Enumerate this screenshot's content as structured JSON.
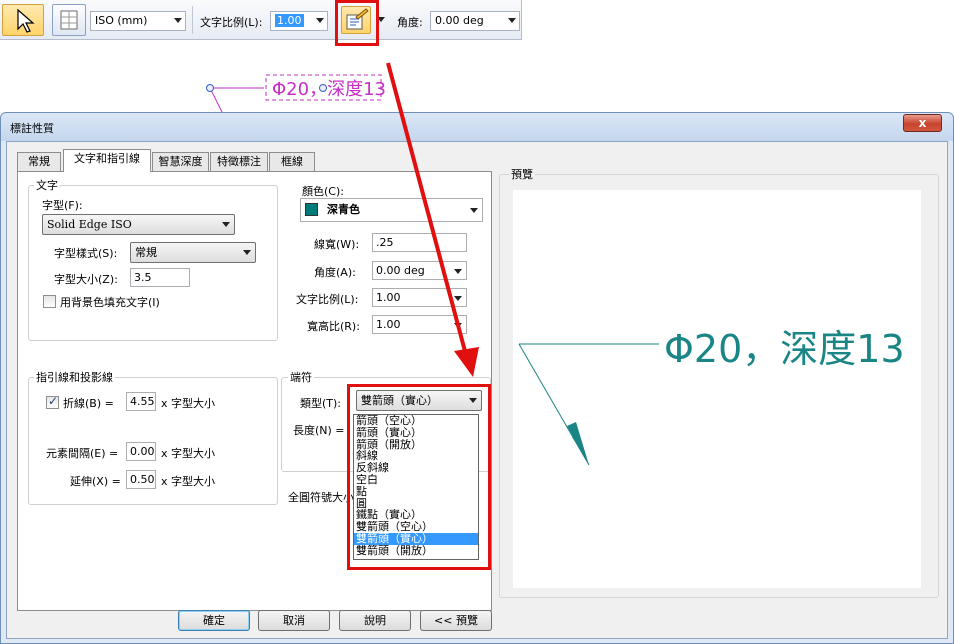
{
  "toolbar": {
    "standard_value": "ISO (mm)",
    "text_ratio_label": "文字比例(L):",
    "text_ratio_value": "1.00",
    "angle_label": "角度:",
    "angle_value": "0.00 deg"
  },
  "callout": {
    "text": "Φ20，深度13"
  },
  "dialog": {
    "title": "標註性質",
    "close_label": "x",
    "tabs": [
      "常規",
      "文字和指引線",
      "智慧深度",
      "特徵標注",
      "框線"
    ],
    "text_group": {
      "title": "文字",
      "font_label": "字型(F):",
      "font_value": "Solid Edge ISO",
      "style_label": "字型樣式(S):",
      "style_value": "常規",
      "size_label": "字型大小(Z):",
      "size_value": "3.5",
      "fill_label": "用背景色填充文字(I)"
    },
    "right_fields": {
      "color_label": "顏色(C):",
      "color_value": "深青色",
      "color_swatch": "#007b7b",
      "line_width_label": "線寬(W):",
      "line_width_value": ".25",
      "angle_label": "角度(A):",
      "angle_value": "0.00 deg",
      "ratio_label": "文字比例(L):",
      "ratio_value": "1.00",
      "aspect_label": "寬高比(R):",
      "aspect_value": "1.00"
    },
    "leader_group": {
      "title": "指引線和投影線",
      "break_label": "折線(B) =",
      "break_value": "4.55",
      "unit": "x 字型大小",
      "gap_label": "元素間隔(E) =",
      "gap_value": "0.00",
      "extend_label": "延伸(X) =",
      "extend_value": "0.50"
    },
    "terminator_group": {
      "title": "端符",
      "type_label": "類型(T):",
      "type_value": "雙箭頭（實心）",
      "length_label": "長度(N) =",
      "full_circle_label": "全圓符號大小"
    },
    "type_options": [
      "箭頭（空心）",
      "箭頭（實心）",
      "箭頭（開放）",
      "斜線",
      "反斜線",
      "空白",
      "點",
      "圓",
      "鐵點（實心）",
      "雙箭頭（空心）",
      "雙箭頭（實心）",
      "雙箭頭（開放）"
    ],
    "selected_option_index": 10,
    "preview": {
      "title": "預覽",
      "text": "Φ20，深度13",
      "color": "#1a8585"
    },
    "buttons": {
      "ok": "確定",
      "cancel": "取消",
      "help": "說明",
      "preview": "<< 預覽"
    }
  },
  "colors": {
    "annotation_magenta": "#c62fc6",
    "highlight_red": "#e01010"
  }
}
